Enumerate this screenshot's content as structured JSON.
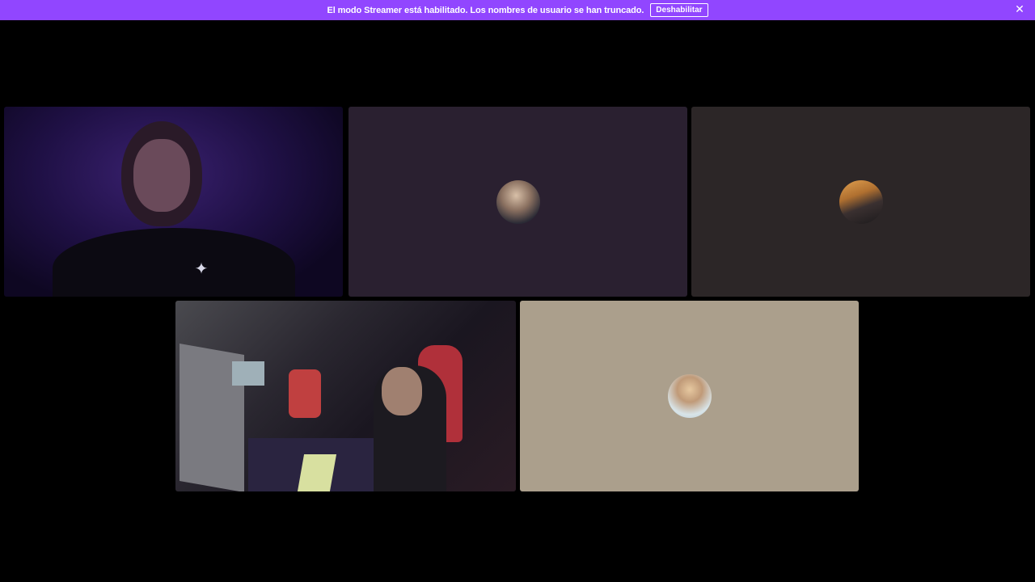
{
  "notice": {
    "message": "El modo Streamer está habilitado. Los nombres de usuario se han truncado.",
    "button_label": "Deshabilitar",
    "close_glyph": "✕",
    "background_color": "#9146ff"
  },
  "tiles": [
    {
      "kind": "camera",
      "background_color": "#1f1045",
      "shirt_logo_glyph": "✦"
    },
    {
      "kind": "avatar",
      "background_color": "#2a2030"
    },
    {
      "kind": "avatar",
      "background_color": "#2c2627"
    },
    {
      "kind": "camera",
      "background_color": "#1a1620"
    },
    {
      "kind": "avatar",
      "background_color": "#ab9f8c"
    }
  ]
}
